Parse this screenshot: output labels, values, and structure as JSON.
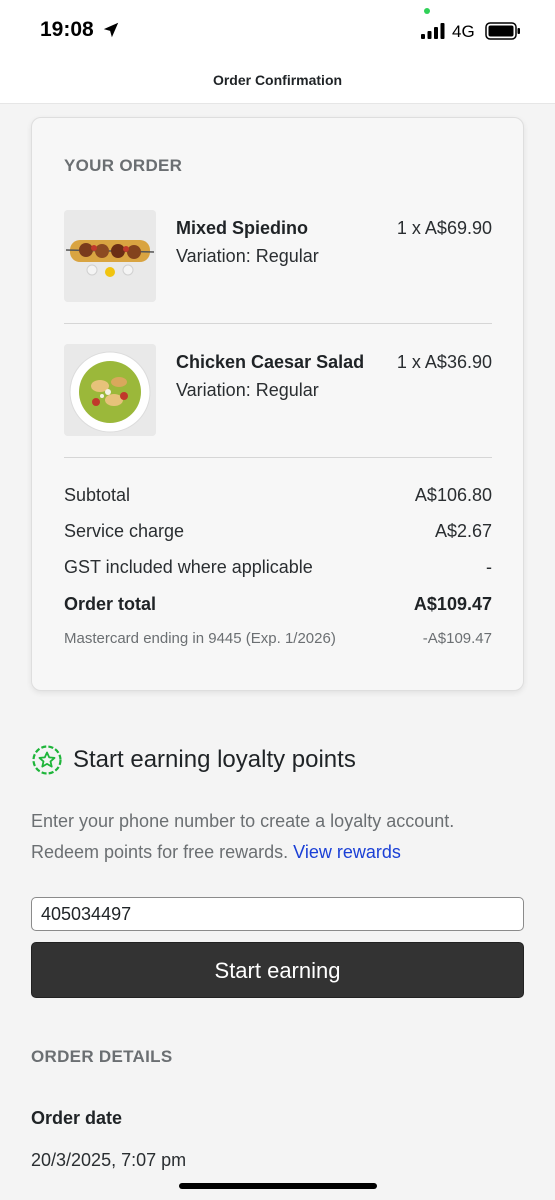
{
  "status_bar": {
    "time": "19:08",
    "network": "4G"
  },
  "header": {
    "title": "Order Confirmation"
  },
  "order": {
    "heading": "YOUR ORDER",
    "items": [
      {
        "name": "Mixed Spiedino",
        "variation": "Variation: Regular",
        "price": "1 x A$69.90",
        "image_icon": "skewer-dish-photo"
      },
      {
        "name": "Chicken Caesar Salad",
        "variation": "Variation: Regular",
        "price": "1 x A$36.90",
        "image_icon": "salad-bowl-photo"
      }
    ],
    "summary": {
      "subtotal_label": "Subtotal",
      "subtotal_value": "A$106.80",
      "service_label": "Service charge",
      "service_value": "A$2.67",
      "gst_label": "GST included where applicable",
      "gst_value": "-",
      "total_label": "Order total",
      "total_value": "A$109.47",
      "payment_label": "Mastercard ending in 9445 (Exp. 1/2026)",
      "payment_value": "-A$109.47"
    }
  },
  "loyalty": {
    "title": "Start earning loyalty points",
    "text": "Enter your phone number to create a loyalty account. Redeem points for free rewards.",
    "link": "View rewards",
    "phone_value": "405034497",
    "button_label": "Start earning"
  },
  "details": {
    "heading": "ORDER DETAILS",
    "date_label": "Order date",
    "date_value": "20/3/2025, 7:07 pm"
  },
  "colors": {
    "accent_green": "#1eb53a",
    "link_blue": "#1a3fd6",
    "button_dark": "#333333"
  }
}
